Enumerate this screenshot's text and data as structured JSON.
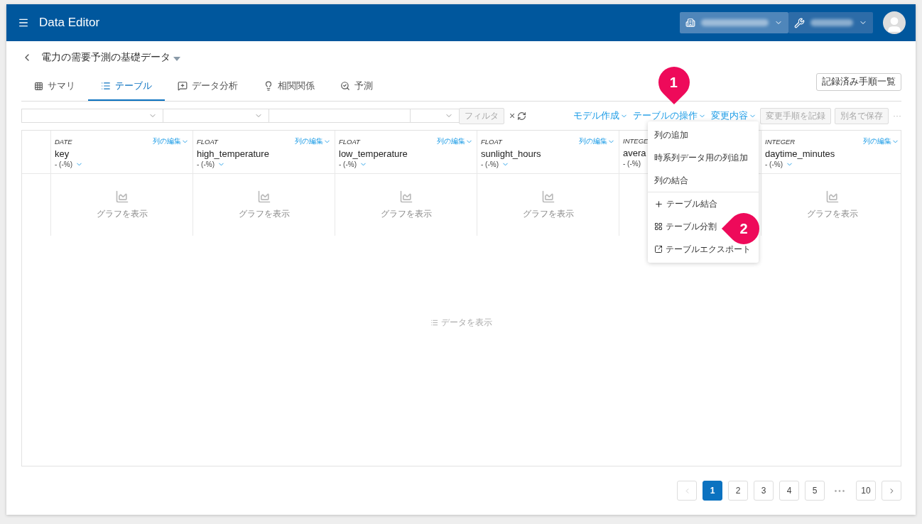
{
  "app": {
    "title": "Data Editor"
  },
  "dataset": {
    "title": "電力の需要予測の基礎データ"
  },
  "tabs": [
    {
      "label": "サマリ",
      "selected": false
    },
    {
      "label": "テーブル",
      "selected": true
    },
    {
      "label": "データ分析",
      "selected": false
    },
    {
      "label": "相関関係",
      "selected": false
    },
    {
      "label": "予測",
      "selected": false
    }
  ],
  "recorded_steps_button": "記録済み手順一覧",
  "filter_bar": {
    "button": "フィルタ",
    "clear": "×"
  },
  "actions": [
    {
      "label": "モデル作成"
    },
    {
      "label": "テーブルの操作"
    },
    {
      "label": "変更内容"
    }
  ],
  "action_buttons": [
    {
      "label": "変更手順を記録",
      "disabled": true
    },
    {
      "label": "別名で保存",
      "disabled": true
    }
  ],
  "more": "···",
  "columns": [
    {
      "type": "DATE",
      "name": "key",
      "edit": "列の編集",
      "stat": "- (-%)",
      "graph": "グラフを表示"
    },
    {
      "type": "FLOAT",
      "name": "high_temperature",
      "edit": "列の編集",
      "stat": "- (-%)",
      "graph": "グラフを表示"
    },
    {
      "type": "FLOAT",
      "name": "low_temperature",
      "edit": "列の編集",
      "stat": "- (-%)",
      "graph": "グラフを表示"
    },
    {
      "type": "FLOAT",
      "name": "sunlight_hours",
      "edit": "列の編集",
      "stat": "- (-%)",
      "graph": "グラフを表示"
    },
    {
      "type": "INTEGE",
      "name": "avera",
      "stat": "- (-%)"
    },
    {
      "type": "INTEGER",
      "name": "daytime_minutes",
      "edit": "列の編集",
      "stat": "- (-%)",
      "graph": "グラフを表示"
    }
  ],
  "show_data": "データを表示",
  "menu": {
    "groups": [
      [
        {
          "label": "列の追加",
          "kind": "plain"
        },
        {
          "label": "時系列データ用の列追加",
          "kind": "plain"
        },
        {
          "label": "列の結合",
          "kind": "plain"
        }
      ],
      [
        {
          "label": "テーブル結合",
          "kind": "plus"
        },
        {
          "label": "テーブル分割",
          "kind": "grid"
        },
        {
          "label": "テーブルエクスポート",
          "kind": "export"
        }
      ]
    ]
  },
  "callouts": [
    {
      "label": "1"
    },
    {
      "label": "2"
    }
  ],
  "pagination": {
    "pages": [
      {
        "label": "1",
        "selected": true
      },
      {
        "label": "2",
        "selected": false
      },
      {
        "label": "3",
        "selected": false
      },
      {
        "label": "4",
        "selected": false
      },
      {
        "label": "5",
        "selected": false
      },
      {
        "label": "•••",
        "kind": "gap"
      },
      {
        "label": "10",
        "selected": false
      }
    ],
    "prev_disabled": true,
    "next_disabled": false
  }
}
